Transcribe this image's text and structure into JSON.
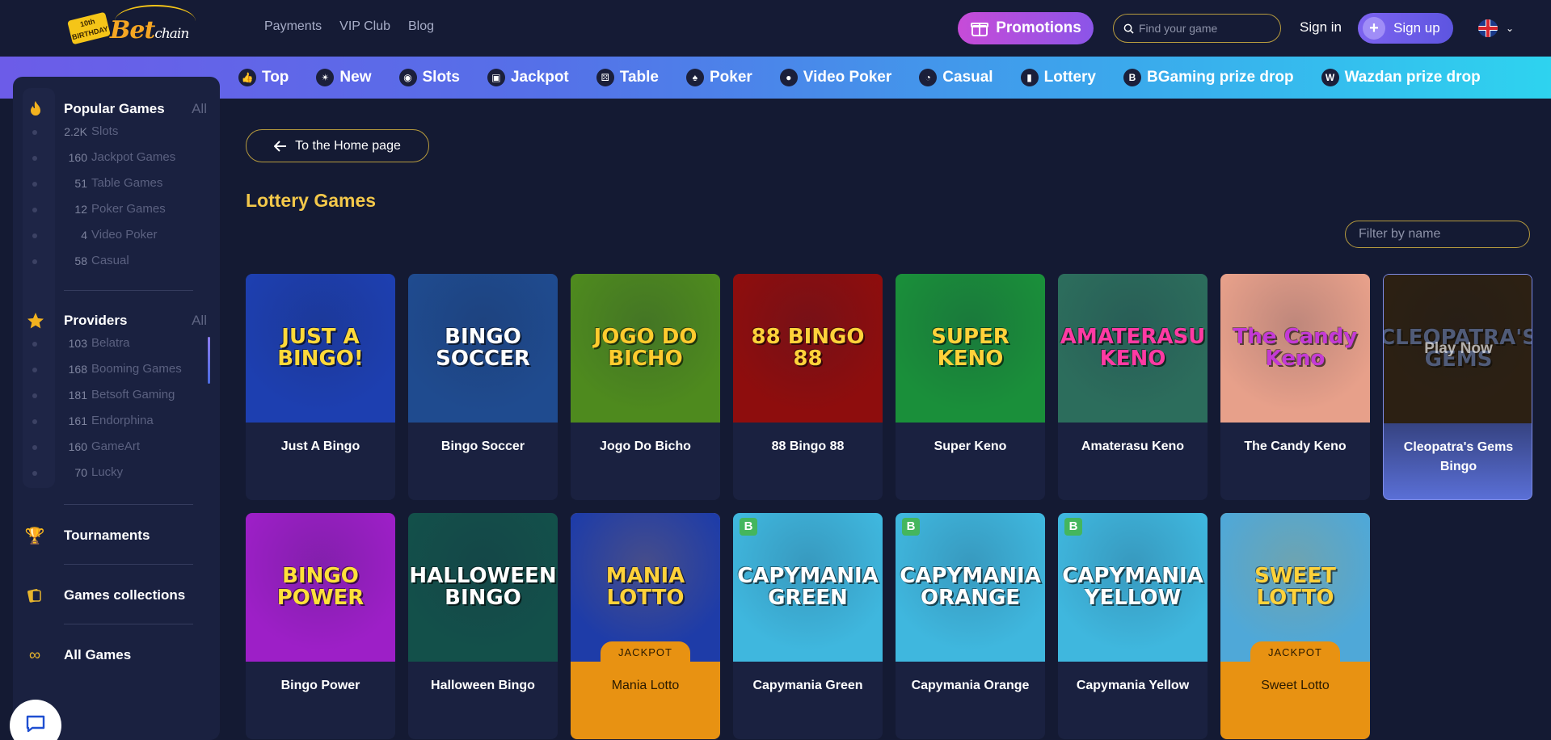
{
  "header": {
    "logo_text": "Bet",
    "logo_suffix": "chain",
    "logo_badge": "10th BIRTHDAY",
    "nav": [
      "Payments",
      "VIP Club",
      "Blog"
    ],
    "promotions_label": "Promotions",
    "search_placeholder": "Find your game",
    "signin_label": "Sign in",
    "signup_label": "Sign up",
    "language": "EN"
  },
  "categories": [
    {
      "label": "Top",
      "icon": "thumbs-up-icon"
    },
    {
      "label": "New",
      "icon": "new-badge-icon"
    },
    {
      "label": "Slots",
      "icon": "slot-machine-icon"
    },
    {
      "label": "Jackpot",
      "icon": "jackpot-icon"
    },
    {
      "label": "Table",
      "icon": "dice-icon"
    },
    {
      "label": "Poker",
      "icon": "poker-chip-icon"
    },
    {
      "label": "Video Poker",
      "icon": "people-icon"
    },
    {
      "label": "Casual",
      "icon": "casual-icon"
    },
    {
      "label": "Lottery",
      "icon": "ticket-icon"
    },
    {
      "label": "BGaming prize drop",
      "icon": "bgaming-icon"
    },
    {
      "label": "Wazdan prize drop",
      "icon": "wazdan-icon"
    }
  ],
  "sidebar": {
    "popular": {
      "title": "Popular Games",
      "all_label": "All",
      "items": [
        {
          "count": "2.2K",
          "label": "Slots"
        },
        {
          "count": "160",
          "label": "Jackpot Games"
        },
        {
          "count": "51",
          "label": "Table Games"
        },
        {
          "count": "12",
          "label": "Poker Games"
        },
        {
          "count": "4",
          "label": "Video Poker"
        },
        {
          "count": "58",
          "label": "Casual"
        }
      ]
    },
    "providers": {
      "title": "Providers",
      "all_label": "All",
      "items": [
        {
          "count": "103",
          "label": "Belatra"
        },
        {
          "count": "168",
          "label": "Booming Games"
        },
        {
          "count": "181",
          "label": "Betsoft Gaming"
        },
        {
          "count": "161",
          "label": "Endorphina"
        },
        {
          "count": "160",
          "label": "GameArt"
        },
        {
          "count": "70",
          "label": "Lucky"
        }
      ]
    },
    "links": [
      {
        "label": "Tournaments",
        "icon": "trophy-icon"
      },
      {
        "label": "Games collections",
        "icon": "collections-icon"
      },
      {
        "label": "All Games",
        "icon": "infinity-icon"
      }
    ]
  },
  "main": {
    "home_button": "To the Home page",
    "title": "Lottery Games",
    "filter_placeholder": "Filter by name",
    "hover_overlay": "Play Now",
    "jackpot_badge": "JACKPOT",
    "games": [
      {
        "name": "Just A Bingo",
        "art": "JUST A BINGO!",
        "bg": "#1d3fb0",
        "fg": "#ffd93a",
        "jackpot": false
      },
      {
        "name": "Bingo Soccer",
        "art": "BINGO SOCCER",
        "bg": "#1f4b8f",
        "fg": "#ffffff",
        "jackpot": false
      },
      {
        "name": "Jogo Do Bicho",
        "art": "JOGO DO BICHO",
        "bg": "#4e8a1e",
        "fg": "#ffcb2e",
        "jackpot": false
      },
      {
        "name": "88 Bingo 88",
        "art": "88 BINGO 88",
        "bg": "#8e0d0d",
        "fg": "#ffd23a",
        "jackpot": false
      },
      {
        "name": "Super Keno",
        "art": "SUPER KENO",
        "bg": "#1a8f3a",
        "fg": "#ffd23a",
        "jackpot": false
      },
      {
        "name": "Amaterasu Keno",
        "art": "AMATERASU KENO",
        "bg": "#2c6d5c",
        "fg": "#ff3aa3",
        "jackpot": false
      },
      {
        "name": "The Candy Keno",
        "art": "The Candy Keno",
        "bg": "#e7a08a",
        "fg": "#c43ad6",
        "jackpot": false
      },
      {
        "name": "Cleopatra's Gems Bingo",
        "art": "CLEOPATRA'S GEMS",
        "bg": "#4a3420",
        "fg": "#9ab5ff",
        "jackpot": false
      },
      {
        "name": "Bingo Power",
        "art": "BINGO POWER",
        "bg": "#9d1fc7",
        "fg": "#ffe13a",
        "jackpot": false
      },
      {
        "name": "Halloween Bingo",
        "art": "HALLOWEEN BINGO",
        "bg": "#13504a",
        "fg": "#ffffff",
        "jackpot": false
      },
      {
        "name": "Mania Lotto",
        "art": "MANIA LOTTO",
        "bg": "#1e3ca8",
        "fg": "#ffd23a",
        "jackpot": true
      },
      {
        "name": "Capymania Green",
        "art": "CAPYMANIA GREEN",
        "bg": "#3fb7de",
        "fg": "#ffffff",
        "jackpot": false
      },
      {
        "name": "Capymania Orange",
        "art": "CAPYMANIA ORANGE",
        "bg": "#3fb7de",
        "fg": "#ffffff",
        "jackpot": false
      },
      {
        "name": "Capymania Yellow",
        "art": "CAPYMANIA YELLOW",
        "bg": "#3fb7de",
        "fg": "#ffffff",
        "jackpot": false
      },
      {
        "name": "Sweet Lotto",
        "art": "SWEET LOTTO",
        "bg": "#4fa8d8",
        "fg": "#ffd23a",
        "jackpot": true
      }
    ]
  },
  "colors": {
    "accent_gold": "#f3c84a",
    "jackpot_orange": "#e89212",
    "promo_purple": "#c74bd8",
    "background": "#141a33"
  }
}
